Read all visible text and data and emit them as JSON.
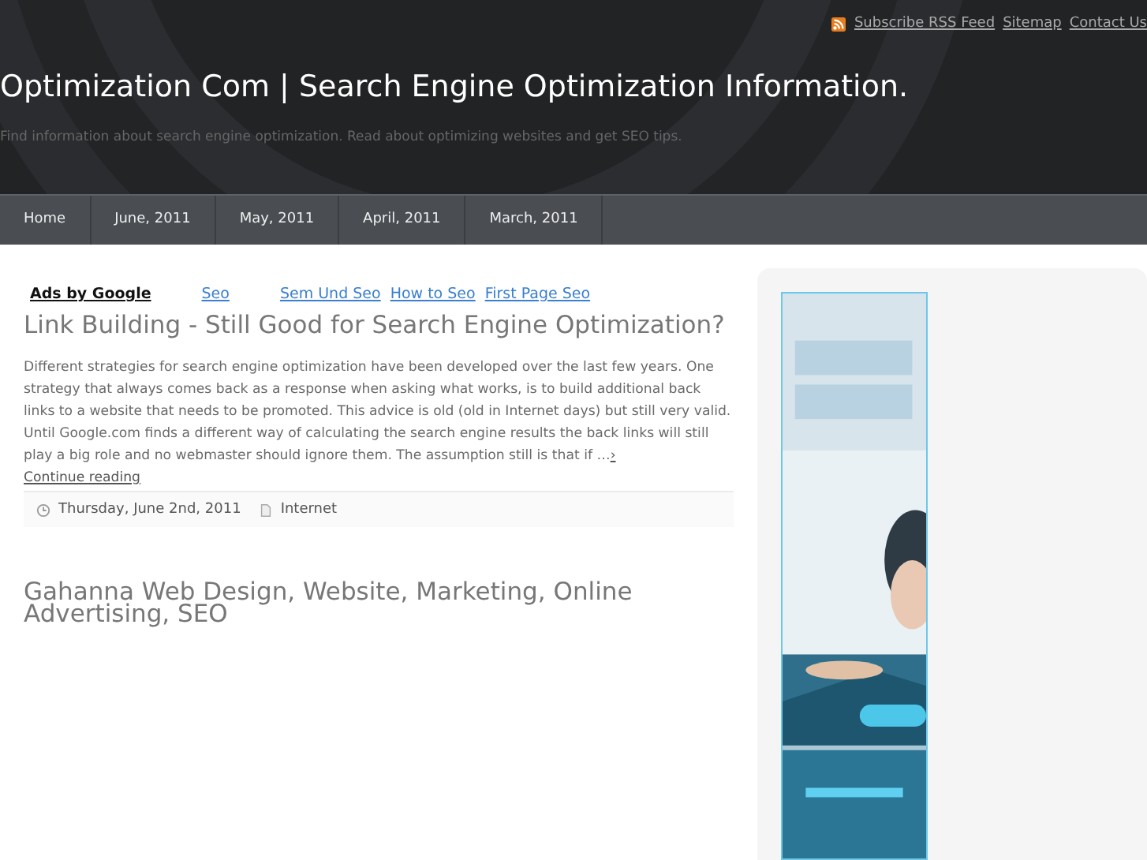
{
  "top_links": [
    {
      "label": "Subscribe RSS Feed",
      "kind": "rss"
    },
    {
      "label": "Sitemap",
      "kind": "plain"
    },
    {
      "label": "Contact Us",
      "kind": "plain"
    }
  ],
  "site": {
    "title": "Optimization Com | Search Engine Optimization Information.",
    "tagline": "Find information about search engine optimization. Read about optimizing websites and get SEO tips."
  },
  "nav": [
    "Home",
    "June, 2011",
    "May, 2011",
    "April, 2011",
    "March, 2011"
  ],
  "ads": {
    "label": "Ads by Google",
    "links": [
      "Seo",
      "Sem Und Seo",
      "How to Seo",
      "First Page Seo"
    ]
  },
  "posts": [
    {
      "title": "Link Building - Still Good for Search Engine Optimization?",
      "excerpt": "Different strategies for search engine optimization have been developed over the last few years. One strategy that always comes back as a response when asking what works, is to build additional back links to a website that needs to be promoted. This advice is old (old in Internet days) but still very valid. Until Google.com finds a different way of calculating the search engine results the back links will still play a big role and no webmaster should ignore them. The assumption still is that if …",
      "more": "›",
      "continue": "Continue reading",
      "date": "Thursday, June 2nd, 2011",
      "category": "Internet"
    },
    {
      "title": "Gahanna Web Design, Website, Marketing, Online Advertising, SEO"
    }
  ]
}
